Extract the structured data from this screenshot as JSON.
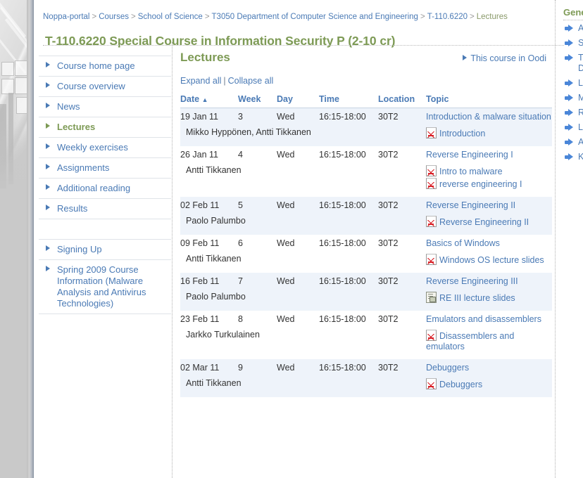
{
  "breadcrumb": {
    "items": [
      "Noppa-portal",
      "Courses",
      "School of Science",
      "T3050 Department of Computer Science and Engineering",
      "T-110.6220",
      "Lectures"
    ],
    "separator": ">"
  },
  "page_title": "T-110.6220 Special Course in Information Security P (2-10 cr)",
  "sidebar": {
    "group1": [
      {
        "label": "Course home page",
        "active": false
      },
      {
        "label": "Course overview",
        "active": false
      },
      {
        "label": "News",
        "active": false
      },
      {
        "label": "Lectures",
        "active": true
      },
      {
        "label": "Weekly exercises",
        "active": false
      },
      {
        "label": "Assignments",
        "active": false
      },
      {
        "label": "Additional reading",
        "active": false
      },
      {
        "label": "Results",
        "active": false
      }
    ],
    "group2": [
      {
        "label": "Signing Up",
        "active": false
      },
      {
        "label": "Spring 2009 Course Information (Malware Analysis and Antivirus Technologies)",
        "active": false
      }
    ]
  },
  "main": {
    "heading": "Lectures",
    "oodi_link": "This course in Oodi",
    "expand_all": "Expand all",
    "collapse_all": "Collapse all",
    "separator": "|",
    "table": {
      "headers": [
        "Date",
        "Week",
        "Day",
        "Time",
        "Location",
        "Topic"
      ],
      "sort_column": "Date",
      "sort_indicator": "▲",
      "rows": [
        {
          "date": "19 Jan 11",
          "week": "3",
          "day": "Wed",
          "time": "16:15-18:00",
          "location": "30T2",
          "topic": "Introduction & malware situation",
          "lecturer": "Mikko Hyppönen, Antti Tikkanen",
          "materials": [
            {
              "name": "Introduction",
              "icon": "pdf-icon"
            }
          ]
        },
        {
          "date": "26 Jan 11",
          "week": "4",
          "day": "Wed",
          "time": "16:15-18:00",
          "location": "30T2",
          "topic": "Reverse Engineering I",
          "lecturer": "Antti Tikkanen",
          "materials": [
            {
              "name": "Intro to malware",
              "icon": "pdf-icon"
            },
            {
              "name": "reverse engineering I",
              "icon": "pdf-icon"
            }
          ]
        },
        {
          "date": "02 Feb 11",
          "week": "5",
          "day": "Wed",
          "time": "16:15-18:00",
          "location": "30T2",
          "topic": "Reverse Engineering II",
          "lecturer": "Paolo Palumbo",
          "materials": [
            {
              "name": "Reverse Engineering II",
              "icon": "pdf-icon"
            }
          ]
        },
        {
          "date": "09 Feb 11",
          "week": "6",
          "day": "Wed",
          "time": "16:15-18:00",
          "location": "30T2",
          "topic": "Basics of Windows",
          "lecturer": "Antti Tikkanen",
          "materials": [
            {
              "name": "Windows OS lecture slides",
              "icon": "pdf-icon"
            }
          ]
        },
        {
          "date": "16 Feb 11",
          "week": "7",
          "day": "Wed",
          "time": "16:15-18:00",
          "location": "30T2",
          "topic": "Reverse Engineering III",
          "lecturer": "Paolo Palumbo",
          "materials": [
            {
              "name": "RE III lecture slides",
              "icon": "document-icon"
            }
          ]
        },
        {
          "date": "23 Feb 11",
          "week": "8",
          "day": "Wed",
          "time": "16:15-18:00",
          "location": "30T2",
          "topic": "Emulators and disassemblers",
          "lecturer": "Jarkko Turkulainen",
          "materials": [
            {
              "name": "Disassemblers and emulators",
              "icon": "pdf-icon"
            }
          ]
        },
        {
          "date": "02 Mar 11",
          "week": "9",
          "day": "Wed",
          "time": "16:15-18:00",
          "location": "30T2",
          "topic": "Debuggers",
          "lecturer": "Antti Tikkanen",
          "materials": [
            {
              "name": "Debuggers",
              "icon": "pdf-icon"
            }
          ]
        }
      ]
    }
  },
  "right_panel": {
    "title": "Gene",
    "items": [
      {
        "label": "A",
        "label2": ""
      },
      {
        "label": "S",
        "label2": ""
      },
      {
        "label": "T",
        "label2": "D"
      },
      {
        "label": "L",
        "label2": ""
      },
      {
        "label": "M",
        "label2": ""
      },
      {
        "label": "R",
        "label2": ""
      },
      {
        "label": "L",
        "label2": ""
      },
      {
        "label": "A",
        "label2": ""
      },
      {
        "label": "K",
        "label2": ""
      }
    ]
  },
  "colors": {
    "title_green": "#7d9a55",
    "link_blue": "#4a7ab5",
    "row_stripe": "#eef3fa",
    "pdf_red": "#d81f26",
    "arrow_blue": "#4a86d8"
  }
}
